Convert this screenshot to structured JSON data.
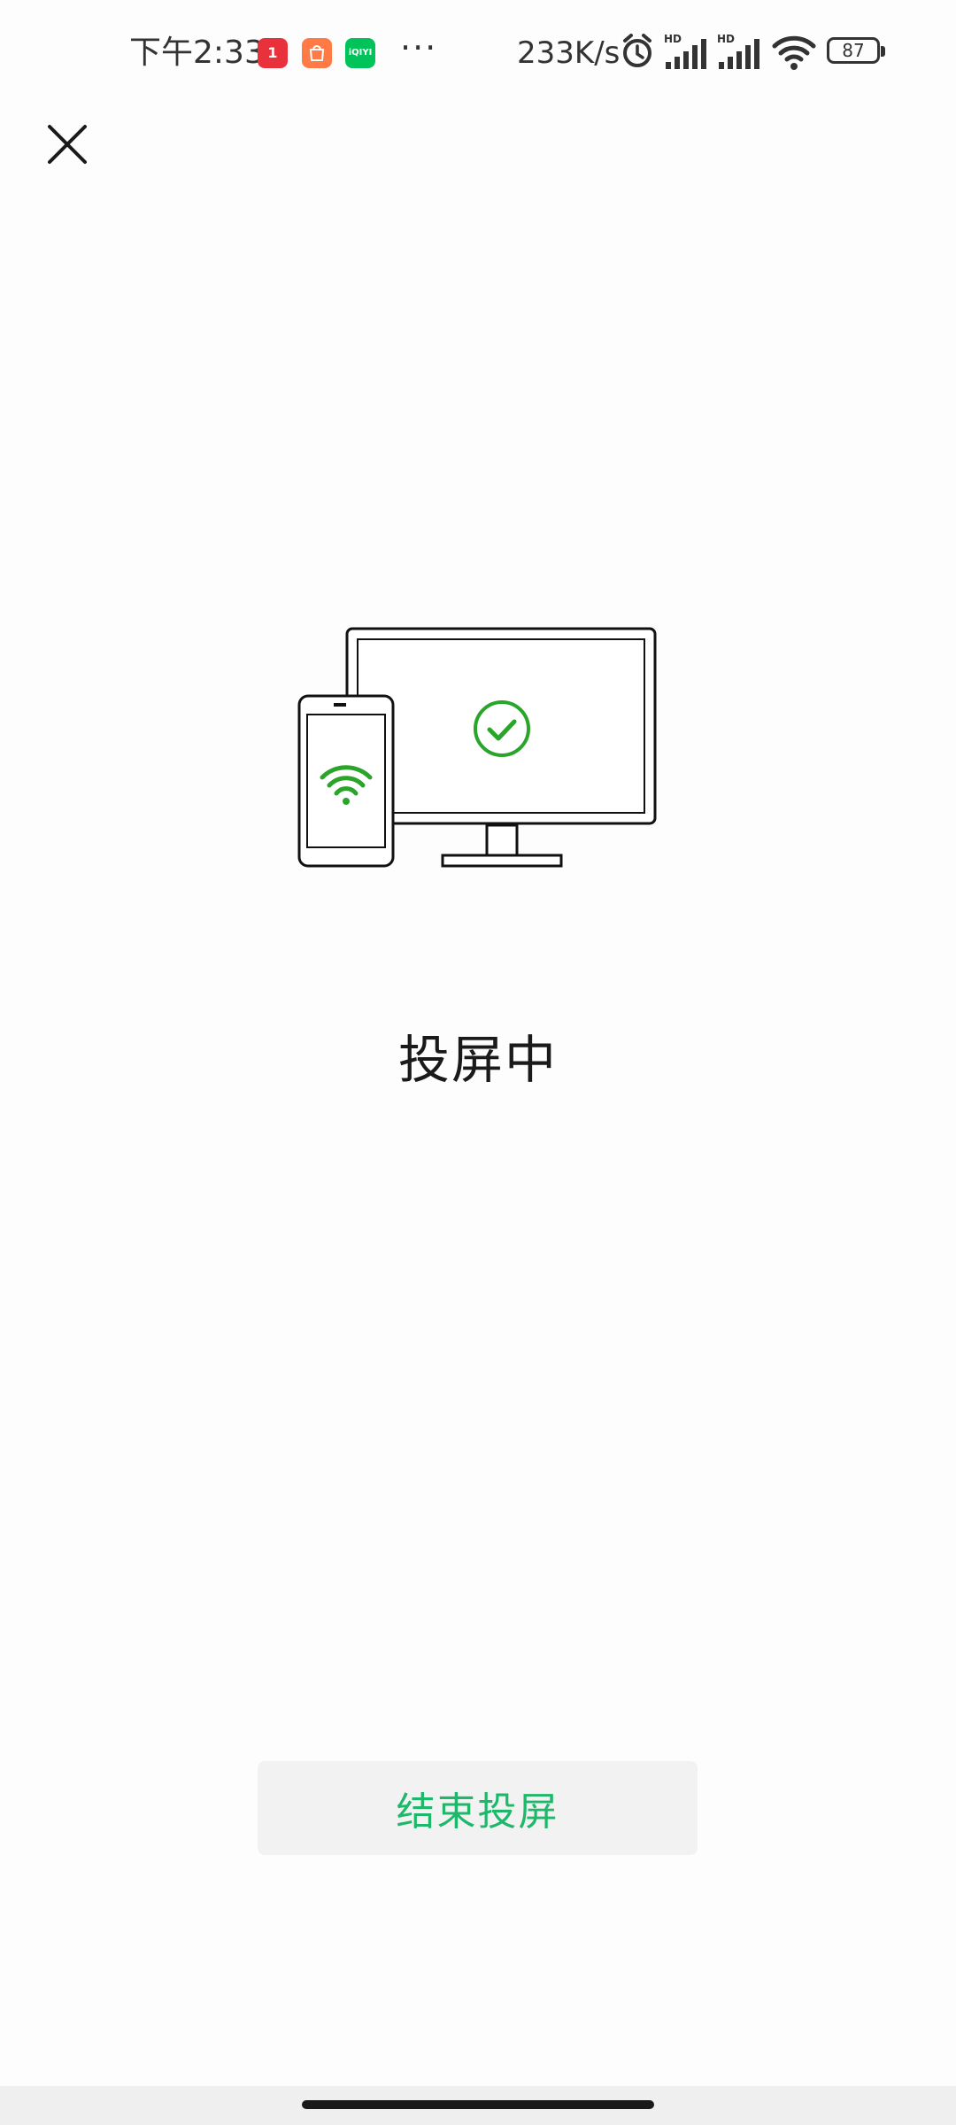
{
  "status_bar": {
    "time": "下午2:33",
    "app_icons": [
      {
        "name": "yihaodian-app-icon",
        "label": "1",
        "color": "#e8313a"
      },
      {
        "name": "shopping-bag-app-icon",
        "label": "",
        "color": "#ff7a45"
      },
      {
        "name": "iqiyi-app-icon",
        "label": "iQIYI",
        "color": "#00c45a"
      }
    ],
    "more": "···",
    "net_speed": "233K/s",
    "battery": "87",
    "indicators": [
      "alarm-icon",
      "hd-signal-icon",
      "hd-signal-icon",
      "wifi-icon",
      "battery-icon"
    ]
  },
  "screen": {
    "status_label": "投屏中",
    "end_button_label": "结束投屏"
  },
  "colors": {
    "accent_green": "#1fb86a",
    "illustration_green": "#2aa52a",
    "background": "#fdfdfd"
  }
}
